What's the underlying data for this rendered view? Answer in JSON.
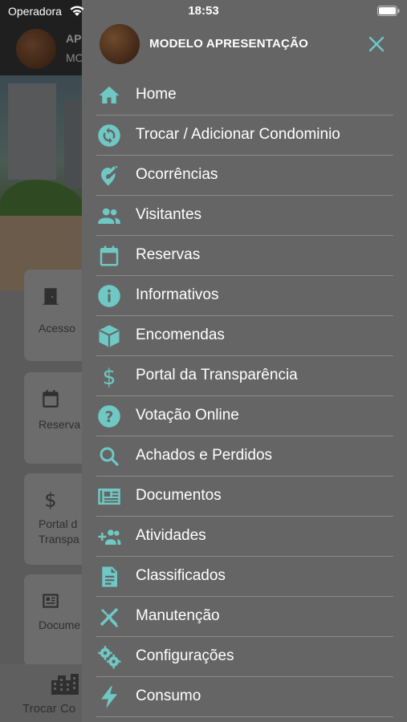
{
  "status_bar": {
    "carrier": "Operadora",
    "time": "18:53"
  },
  "background": {
    "header": {
      "title": "AP",
      "subtitle": "MO"
    },
    "cards": [
      {
        "label": "Acesso",
        "icon": "door-icon"
      },
      {
        "label": "Reserva",
        "icon": "calendar-icon"
      },
      {
        "label": "Portal d",
        "label2": "Transpa",
        "icon": "dollar-icon"
      },
      {
        "label": "Docume",
        "icon": "document-icon"
      }
    ],
    "bottom_bar": {
      "label": "Trocar Co",
      "icon": "buildings-icon"
    }
  },
  "drawer": {
    "title": "MODELO APRESENTAÇÃO",
    "accent_color": "#6fc8c4",
    "items": [
      {
        "label": "Home",
        "icon": "home-icon"
      },
      {
        "label": "Trocar / Adicionar Condominio",
        "icon": "sync-icon"
      },
      {
        "label": "Ocorrências",
        "icon": "pin-edit-icon"
      },
      {
        "label": "Visitantes",
        "icon": "people-icon"
      },
      {
        "label": "Reservas",
        "icon": "calendar-icon"
      },
      {
        "label": "Informativos",
        "icon": "info-icon"
      },
      {
        "label": "Encomendas",
        "icon": "package-icon"
      },
      {
        "label": "Portal da Transparência",
        "icon": "dollar-icon"
      },
      {
        "label": "Votação Online",
        "icon": "help-icon"
      },
      {
        "label": "Achados e Perdidos",
        "icon": "search-icon"
      },
      {
        "label": "Documentos",
        "icon": "newspaper-icon"
      },
      {
        "label": "Atividades",
        "icon": "group-add-icon"
      },
      {
        "label": "Classificados",
        "icon": "document-icon"
      },
      {
        "label": "Manutenção",
        "icon": "tools-icon"
      },
      {
        "label": "Configurações",
        "icon": "gears-icon"
      },
      {
        "label": "Consumo",
        "icon": "bolt-icon"
      }
    ]
  }
}
